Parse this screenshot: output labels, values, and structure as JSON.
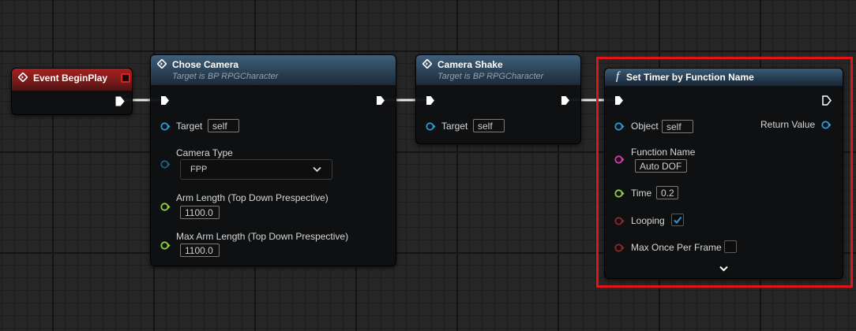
{
  "nodes": {
    "event_begin_play": {
      "title": "Event BeginPlay"
    },
    "chose_camera": {
      "title": "Chose Camera",
      "subtitle": "Target is BP RPGCharacter",
      "target_label": "Target",
      "target_value": "self",
      "camera_type_label": "Camera Type",
      "camera_type_value": "FPP",
      "arm_length_label": "Arm Length (Top Down Prespective)",
      "arm_length_value": "1100.0",
      "max_arm_length_label": "Max Arm Length (Top Down Prespective)",
      "max_arm_length_value": "1100.0"
    },
    "camera_shake": {
      "title": "Camera Shake",
      "subtitle": "Target is BP RPGCharacter",
      "target_label": "Target",
      "target_value": "self"
    },
    "set_timer": {
      "function_glyph": "f",
      "title": "Set Timer by Function Name",
      "object_label": "Object",
      "object_value": "self",
      "return_value_label": "Return Value",
      "function_name_label": "Function Name",
      "function_name_value": "Auto DOF",
      "time_label": "Time",
      "time_value": "0.2",
      "looping_label": "Looping",
      "looping_checked": true,
      "max_once_label": "Max Once Per Frame",
      "max_once_checked": false
    }
  },
  "colors": {
    "object_pin": "#2b9bd6",
    "string_pin": "#d63ab7",
    "float_pin": "#8fd43a",
    "bool_pin": "#8a2a2a",
    "exec_pin": "#ffffff",
    "highlight": "#e1141a"
  },
  "icons": {
    "event": "diamond-arrow-icon",
    "function_call": "diamond-arrow-icon",
    "function": "italic-f-icon",
    "dropdown": "chevron-down-icon",
    "checkbox": "checkmark-icon",
    "expand": "chevron-down-icon"
  }
}
